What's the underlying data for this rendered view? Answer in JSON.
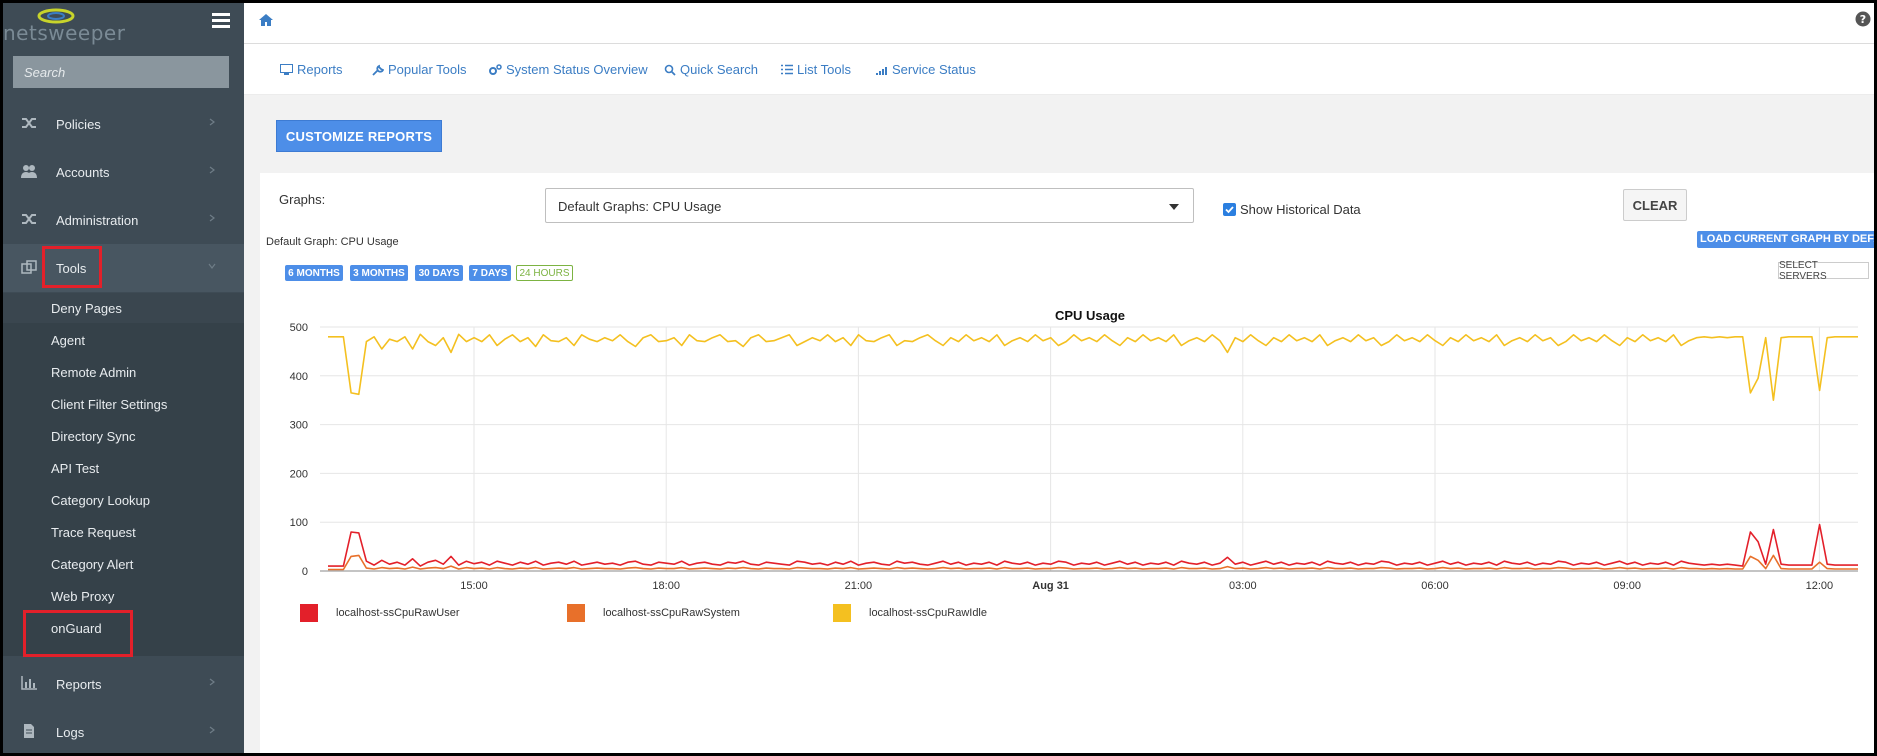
{
  "app": {
    "brand": "netsweeper"
  },
  "sidebar": {
    "search_placeholder": "Search",
    "items": [
      {
        "label": "Policies",
        "icon": "shuffle-icon"
      },
      {
        "label": "Accounts",
        "icon": "users-icon"
      },
      {
        "label": "Administration",
        "icon": "shuffle-icon"
      },
      {
        "label": "Tools",
        "icon": "tools-icon"
      }
    ],
    "tools_sub": [
      "Deny Pages",
      "Agent",
      "Remote Admin",
      "Client Filter Settings",
      "Directory Sync",
      "API Test",
      "Category Lookup",
      "Trace Request",
      "Category Alert",
      "Web Proxy",
      "onGuard"
    ],
    "bottom_items": [
      {
        "label": "Reports",
        "icon": "bar-chart-icon"
      },
      {
        "label": "Logs",
        "icon": "file-icon"
      }
    ]
  },
  "toolbar": {
    "links": [
      {
        "label": "Reports",
        "icon": "monitor-icon"
      },
      {
        "label": "Popular Tools",
        "icon": "wrench-icon"
      },
      {
        "label": "System Status Overview",
        "icon": "gears-icon"
      },
      {
        "label": "Quick Search",
        "icon": "search-icon"
      },
      {
        "label": "List Tools",
        "icon": "list-icon"
      },
      {
        "label": "Service Status",
        "icon": "signal-icon"
      }
    ]
  },
  "content": {
    "customize_label": "CUSTOMIZE REPORTS",
    "graphs_label": "Graphs:",
    "graph_select_value": "Default Graphs: CPU Usage",
    "show_historical_label": "Show Historical Data",
    "show_historical_checked": true,
    "clear_label": "CLEAR",
    "default_caption": "Default Graph: CPU Usage",
    "load_default_label": "LOAD CURRENT GRAPH BY DEFAULT",
    "select_servers_label": "SELECT SERVERS",
    "ranges": [
      "6 MONTHS",
      "3 MONTHS",
      "30 DAYS",
      "7 DAYS",
      "24 HOURS"
    ],
    "active_range": "24 HOURS"
  },
  "chart_data": {
    "type": "line",
    "title": "CPU Usage",
    "xlabel": "",
    "ylabel": "",
    "ylim": [
      0,
      500
    ],
    "yticks": [
      0,
      100,
      200,
      300,
      400,
      500
    ],
    "xticks": [
      "15:00",
      "18:00",
      "21:00",
      "Aug 31",
      "03:00",
      "06:00",
      "09:00",
      "12:00"
    ],
    "grid": true,
    "legend_position": "bottom-left",
    "series": [
      {
        "name": "localhost-ssCpuRawUser",
        "color": "#e3202a",
        "values": [
          10,
          10,
          10,
          80,
          78,
          20,
          12,
          22,
          14,
          18,
          12,
          25,
          10,
          18,
          22,
          14,
          30,
          12,
          20,
          15,
          18,
          12,
          20,
          16,
          12,
          18,
          14,
          20,
          12,
          16,
          18,
          14,
          20,
          12,
          15,
          18,
          14,
          16,
          12,
          18,
          20,
          14,
          12,
          18,
          16,
          14,
          20,
          12,
          16,
          18,
          14,
          12,
          18,
          16,
          20,
          14,
          12,
          18,
          16,
          14,
          12,
          20,
          18,
          14,
          16,
          12,
          18,
          14,
          20,
          12,
          16,
          18,
          14,
          12,
          20,
          16,
          18,
          14,
          12,
          16,
          20,
          14,
          18,
          12,
          16,
          14,
          18,
          12,
          20,
          16,
          14,
          18,
          12,
          16,
          14,
          20,
          18,
          12,
          16,
          14,
          18,
          12,
          16,
          20,
          14,
          18,
          12,
          16,
          14,
          18,
          12,
          20,
          16,
          14,
          18,
          12,
          16,
          28,
          14,
          18,
          12,
          16,
          20,
          14,
          18,
          12,
          16,
          14,
          18,
          12,
          20,
          16,
          14,
          18,
          12,
          16,
          14,
          20,
          18,
          12,
          16,
          14,
          18,
          12,
          16,
          20,
          14,
          18,
          12,
          16,
          14,
          18,
          12,
          20,
          16,
          14,
          18,
          12,
          16,
          14,
          20,
          18,
          12,
          16,
          14,
          18,
          12,
          16,
          20,
          14,
          18,
          12,
          16,
          14,
          18,
          12,
          20,
          16,
          14,
          12,
          14,
          12,
          14,
          12,
          10,
          80,
          60,
          14,
          85,
          14,
          12,
          12,
          12,
          12,
          95,
          14,
          12,
          12,
          12,
          12
        ]
      },
      {
        "name": "localhost-ssCpuRawSystem",
        "color": "#e8702a",
        "values": [
          3,
          3,
          3,
          30,
          32,
          6,
          4,
          7,
          5,
          6,
          4,
          8,
          4,
          6,
          7,
          5,
          10,
          4,
          7,
          5,
          6,
          4,
          7,
          5,
          4,
          6,
          5,
          7,
          4,
          5,
          6,
          5,
          7,
          4,
          5,
          6,
          5,
          5,
          4,
          6,
          7,
          5,
          4,
          6,
          5,
          5,
          7,
          4,
          5,
          6,
          5,
          4,
          6,
          5,
          7,
          5,
          4,
          6,
          5,
          5,
          4,
          7,
          6,
          5,
          5,
          4,
          6,
          5,
          7,
          4,
          5,
          6,
          5,
          4,
          7,
          5,
          6,
          5,
          4,
          5,
          7,
          5,
          6,
          4,
          5,
          5,
          6,
          4,
          7,
          5,
          5,
          6,
          4,
          5,
          5,
          7,
          6,
          4,
          5,
          5,
          6,
          4,
          5,
          7,
          5,
          6,
          4,
          5,
          5,
          6,
          4,
          7,
          5,
          5,
          6,
          4,
          5,
          9,
          5,
          6,
          4,
          5,
          7,
          5,
          6,
          4,
          5,
          5,
          6,
          4,
          7,
          5,
          5,
          6,
          4,
          5,
          5,
          7,
          6,
          4,
          5,
          5,
          6,
          4,
          5,
          7,
          5,
          6,
          4,
          5,
          5,
          6,
          4,
          7,
          5,
          5,
          6,
          4,
          5,
          5,
          7,
          6,
          4,
          5,
          5,
          6,
          4,
          5,
          7,
          5,
          6,
          4,
          5,
          5,
          6,
          4,
          7,
          5,
          5,
          4,
          5,
          4,
          5,
          4,
          4,
          30,
          22,
          5,
          32,
          5,
          4,
          4,
          4,
          4,
          18,
          5,
          4,
          4,
          4,
          4
        ]
      },
      {
        "name": "localhost-ssCpuRawIdle",
        "color": "#f4c020",
        "values": [
          480,
          480,
          480,
          365,
          362,
          470,
          480,
          455,
          475,
          470,
          480,
          455,
          485,
          470,
          462,
          478,
          448,
          485,
          470,
          478,
          470,
          484,
          462,
          475,
          484,
          470,
          478,
          460,
          484,
          472,
          470,
          478,
          462,
          484,
          475,
          470,
          478,
          472,
          484,
          470,
          460,
          478,
          484,
          470,
          472,
          478,
          462,
          484,
          472,
          470,
          478,
          484,
          470,
          472,
          460,
          478,
          484,
          470,
          472,
          478,
          484,
          462,
          470,
          478,
          472,
          484,
          470,
          478,
          462,
          484,
          472,
          470,
          478,
          484,
          462,
          472,
          470,
          478,
          484,
          472,
          462,
          478,
          470,
          484,
          472,
          478,
          470,
          484,
          462,
          472,
          478,
          470,
          484,
          472,
          478,
          462,
          470,
          484,
          472,
          478,
          470,
          484,
          472,
          462,
          478,
          470,
          484,
          472,
          478,
          470,
          484,
          462,
          472,
          478,
          470,
          484,
          472,
          448,
          478,
          470,
          484,
          472,
          462,
          478,
          470,
          484,
          472,
          478,
          470,
          484,
          462,
          472,
          478,
          470,
          484,
          472,
          478,
          462,
          470,
          484,
          472,
          478,
          470,
          484,
          472,
          462,
          478,
          470,
          484,
          472,
          478,
          470,
          484,
          462,
          472,
          478,
          470,
          484,
          472,
          478,
          462,
          470,
          484,
          472,
          478,
          470,
          484,
          472,
          462,
          478,
          470,
          484,
          472,
          478,
          470,
          484,
          462,
          472,
          478,
          480,
          478,
          480,
          478,
          480,
          480,
          365,
          395,
          478,
          350,
          478,
          480,
          480,
          480,
          480,
          370,
          478,
          480,
          480,
          480,
          480
        ]
      }
    ]
  }
}
